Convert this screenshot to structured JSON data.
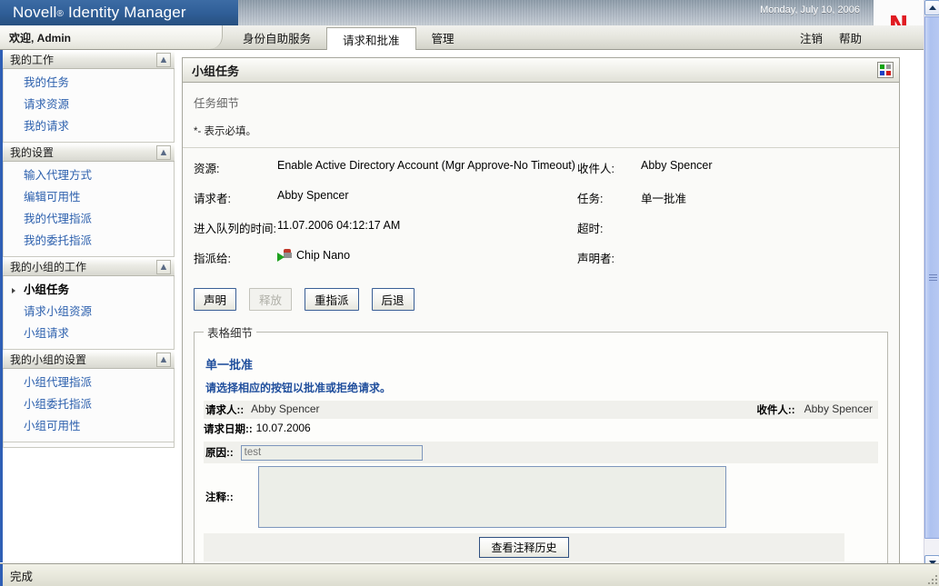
{
  "masthead": {
    "brand": "Novell",
    "registered": "®",
    "product": "Identity Manager",
    "date": "Monday, July 10, 2006",
    "logo_letter": "N",
    "logo_color": "#e01b22",
    "brand_bg": "#2f5d96"
  },
  "tabbar": {
    "welcome": "欢迎, Admin",
    "tabs": [
      {
        "label": "身份自助服务",
        "active": false
      },
      {
        "label": "请求和批准",
        "active": true
      },
      {
        "label": "管理",
        "active": false
      }
    ],
    "links": [
      {
        "label": "注销"
      },
      {
        "label": "帮助"
      }
    ]
  },
  "sidebar": {
    "groups": [
      {
        "header": "我的工作",
        "collapse_icon": "chevron-up-icon",
        "items": [
          {
            "label": "我的任务",
            "selected": false
          },
          {
            "label": "请求资源",
            "selected": false
          },
          {
            "label": "我的请求",
            "selected": false
          }
        ]
      },
      {
        "header": "我的设置",
        "collapse_icon": "chevron-up-icon",
        "items": [
          {
            "label": "输入代理方式",
            "selected": false
          },
          {
            "label": "编辑可用性",
            "selected": false
          },
          {
            "label": "我的代理指派",
            "selected": false
          },
          {
            "label": "我的委托指派",
            "selected": false
          }
        ]
      },
      {
        "header": "我的小组的工作",
        "collapse_icon": "chevron-up-icon",
        "items": [
          {
            "label": "小组任务",
            "selected": true
          },
          {
            "label": "请求小组资源",
            "selected": false
          },
          {
            "label": "小组请求",
            "selected": false
          }
        ]
      },
      {
        "header": "我的小组的设置",
        "collapse_icon": "chevron-up-icon",
        "items": [
          {
            "label": "小组代理指派",
            "selected": false
          },
          {
            "label": "小组委托指派",
            "selected": false
          },
          {
            "label": "小组可用性",
            "selected": false
          }
        ]
      }
    ]
  },
  "panel": {
    "title": "小组任务",
    "grid_icon": "grid-view-icon",
    "subtitle": "任务细节",
    "required_note": "*- 表示必填。",
    "details": [
      {
        "label": "资源:",
        "value": "Enable Active Directory Account (Mgr Approve-No Timeout)",
        "label2": "收件人:",
        "value2": "Abby Spencer"
      },
      {
        "label": "请求者:",
        "value": "Abby Spencer",
        "label2": "任务:",
        "value2": "单一批准"
      },
      {
        "label": "进入队列的时间:",
        "value": "11.07.2006 04:12:17 AM",
        "label2": "超时:",
        "value2": ""
      },
      {
        "label": "指派给:",
        "value": "Chip Nano",
        "value_icon": "user-proxy-icon",
        "label2": "声明者:",
        "value2": ""
      }
    ],
    "buttons": [
      {
        "label": "声明",
        "disabled": false
      },
      {
        "label": "释放",
        "disabled": true
      },
      {
        "label": "重指派",
        "disabled": false
      },
      {
        "label": "后退",
        "disabled": false
      }
    ]
  },
  "form": {
    "legend": "表格细节",
    "title": "单一批准",
    "instruction": "请选择相应的按钮以批准或拒绝请求。",
    "requester_label": "请求人::",
    "requester_value": "Abby Spencer",
    "recipient_label": "收件人::",
    "recipient_value": "Abby Spencer",
    "date_label": "请求日期::",
    "date_value": "10.07.2006",
    "reason_label": "原因::",
    "reason_value": "",
    "reason_placeholder": "test",
    "comment_label": "注释::",
    "comment_value": "",
    "history_button": "查看注释历史"
  },
  "statusbar": {
    "text": "完成"
  },
  "scrollbar": {
    "up_icon": "scroll-up-icon",
    "down_icon": "scroll-down-icon"
  }
}
